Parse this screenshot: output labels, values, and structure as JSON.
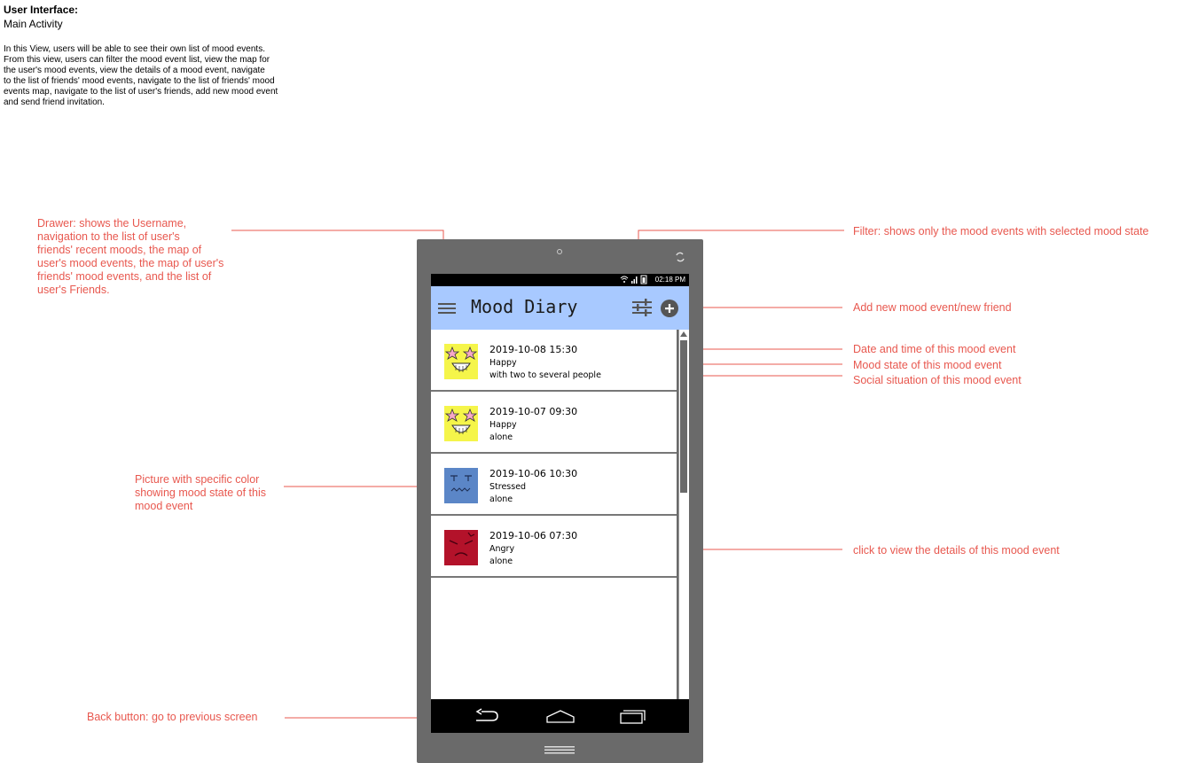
{
  "header": {
    "title": "User Interface:",
    "subtitle": "Main Activity",
    "description": "In this View, users will be able to see their own list of mood events.\nFrom this view, users can filter the mood event list, view the map for\nthe user's mood events, view the details of a mood event, navigate\nto the list of friends' mood events, navigate to the list of friends' mood\nevents map, navigate to the list of user's friends, add new mood event\nand send friend invitation."
  },
  "annotations": {
    "drawer": "Drawer: shows the Username,\nnavigation to the list of user's\nfriends' recent moods, the map of\nuser's mood events, the map of user's\nfriends' mood events, and the list of\nuser's Friends.",
    "filter": "Filter: shows only the mood events with selected mood state",
    "add": "Add new mood event/new friend",
    "date": "Date and time of this mood event",
    "mood": "Mood state of this mood event",
    "social": "Social situation of this mood event",
    "picture": "Picture with specific color\nshowing mood state of this\nmood event",
    "click": "click to view the details of this mood event",
    "back": "Back button: go to previous screen"
  },
  "status_bar": {
    "time": "02:18 PM",
    "icons": "wifi-icon signal-icon battery-icon"
  },
  "app": {
    "title": "Mood Diary",
    "menu_icon": "menu-icon",
    "filter_icon": "filter-icon",
    "add_icon": "add-circle-icon"
  },
  "events": [
    {
      "date": "2019-10-08 15:30",
      "mood": "Happy",
      "social": "with two to several people",
      "icon": "happy-face-icon",
      "color": "#f5f54a"
    },
    {
      "date": "2019-10-07 09:30",
      "mood": "Happy",
      "social": "alone",
      "icon": "happy-face-icon",
      "color": "#f5f54a"
    },
    {
      "date": "2019-10-06 10:30",
      "mood": "Stressed",
      "social": "alone",
      "icon": "stressed-face-icon",
      "color": "#5b86c7"
    },
    {
      "date": "2019-10-06 07:30",
      "mood": "Angry",
      "social": "alone",
      "icon": "angry-face-icon",
      "color": "#b3122a"
    }
  ],
  "nav": {
    "back_icon": "back-icon",
    "home_icon": "home-icon",
    "recents_icon": "recents-icon"
  },
  "colors": {
    "annotation": "#e8584f",
    "app_bar": "#a8c9ff",
    "device": "#6a6a6a"
  }
}
